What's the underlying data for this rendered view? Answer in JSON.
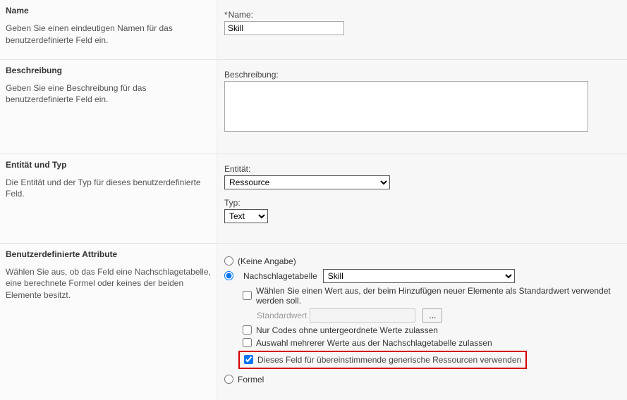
{
  "sections": {
    "name": {
      "title": "Name",
      "description": "Geben Sie einen eindeutigen Namen für das benutzerdefinierte Feld ein.",
      "field_label": "Name:",
      "required_mark": "*",
      "value": "Skill"
    },
    "description": {
      "title": "Beschreibung",
      "description": "Geben Sie eine Beschreibung für das benutzerdefinierte Feld ein.",
      "field_label": "Beschreibung:",
      "value": ""
    },
    "entityType": {
      "title": "Entität und Typ",
      "description": "Die Entität und der Typ für dieses benutzerdefinierte Feld.",
      "entity_label": "Entität:",
      "entity_value": "Ressource",
      "type_label": "Typ:",
      "type_value": "Text"
    },
    "attributes": {
      "title": "Benutzerdefinierte Attribute",
      "description": "Wählen Sie aus, ob das Feld eine Nachschlagetabelle, eine berechnete Formel oder keines der beiden Elemente besitzt.",
      "radio_none": "(Keine Angabe)",
      "radio_lookup": "Nachschlagetabelle",
      "lookup_value": "Skill",
      "check_default": "Wählen Sie einen Wert aus, der beim Hinzufügen neuer Elemente als Standardwert verwendet werden soll.",
      "std_label": "Standardwert",
      "std_value": "",
      "ellipsis_label": "...",
      "check_codes": "Nur Codes ohne untergeordnete Werte zulassen",
      "check_multi": "Auswahl mehrerer Werte aus der Nachschlagetabelle zulassen",
      "check_generic": "Dieses Feld für übereinstimmende generische Ressourcen verwenden",
      "radio_formula": "Formel"
    }
  }
}
